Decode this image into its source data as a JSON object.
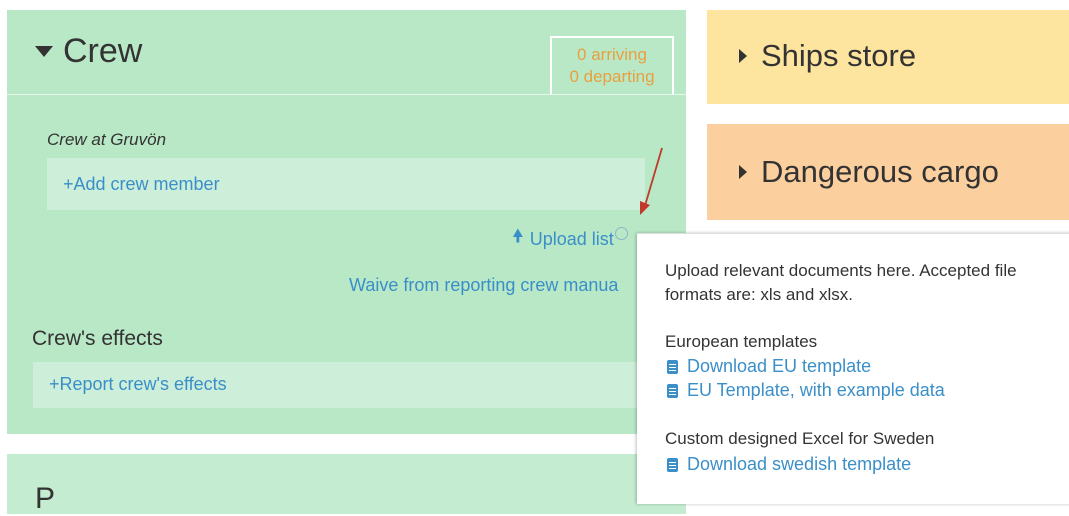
{
  "crew": {
    "title": "Crew",
    "arriving": "0 arriving",
    "departing": "0 departing",
    "location_label": "Crew at Gruvön",
    "add_member": "+Add crew member",
    "upload_list": "Upload list",
    "waive": "Waive from reporting crew manua",
    "effects_title": "Crew's effects",
    "report_effects": "+Report crew's effects"
  },
  "next_panel": {
    "title": "P"
  },
  "ships_store": {
    "title": "Ships store"
  },
  "dangerous_cargo": {
    "title": "Dangerous cargo"
  },
  "tooltip": {
    "description": "Upload relevant documents here. Accepted file formats are: xls and xlsx.",
    "eu_heading": "European templates",
    "eu_download": "Download EU template",
    "eu_example": "EU Template, with example data",
    "se_heading": "Custom designed Excel for Sweden",
    "se_download": "Download swedish template"
  },
  "colors": {
    "crew_bg": "#b8e8c6",
    "link": "#3a8fc9",
    "ships_store_bg": "#fde5a0",
    "dangerous_bg": "#fccf9e",
    "arrival_text": "#e8a040",
    "annotation_arrow": "#c0392b"
  },
  "icons": [
    "chevron-down-icon",
    "chevron-right-icon",
    "upload-arrow-icon",
    "help-icon",
    "document-icon"
  ]
}
